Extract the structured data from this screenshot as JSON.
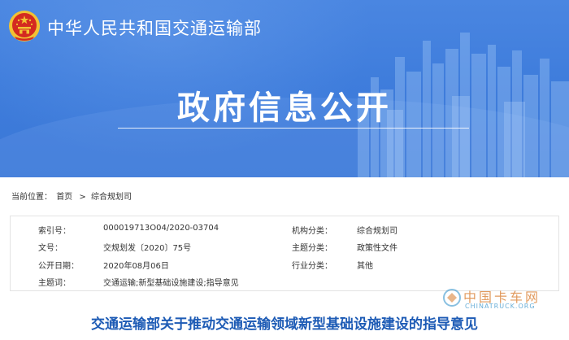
{
  "header": {
    "ministry_name": "中华人民共和国交通运输部",
    "page_heading": "政府信息公开"
  },
  "breadcrumb": {
    "prefix": "当前位置：",
    "items": [
      "首页",
      "综合规划司"
    ],
    "separator": ">"
  },
  "meta": {
    "rows": [
      {
        "k1": "索引号：",
        "v1": "000019713O04/2020-03704",
        "k2": "机构分类：",
        "v2": "综合规划司"
      },
      {
        "k1": "文号：",
        "v1": "交规划发〔2020〕75号",
        "k2": "主题分类：",
        "v2": "政策性文件"
      },
      {
        "k1": "公开日期：",
        "v1": "2020年08月06日",
        "k2": "行业分类：",
        "v2": "其他"
      },
      {
        "k1": "主题词：",
        "v1": "交通运输;新型基础设施建设;指导意见",
        "k2": "",
        "v2": ""
      }
    ]
  },
  "article": {
    "title": "交通运输部关于推动交通运输领域新型基础设施建设的指导意见"
  },
  "watermark": {
    "cn": "中国卡车网",
    "en": "CHINATRUCK.ORG"
  },
  "colors": {
    "banner": "#3f7ddc",
    "title_blue": "#1d5bb5",
    "emblem_red": "#d42a20",
    "emblem_gold": "#f2c233"
  }
}
